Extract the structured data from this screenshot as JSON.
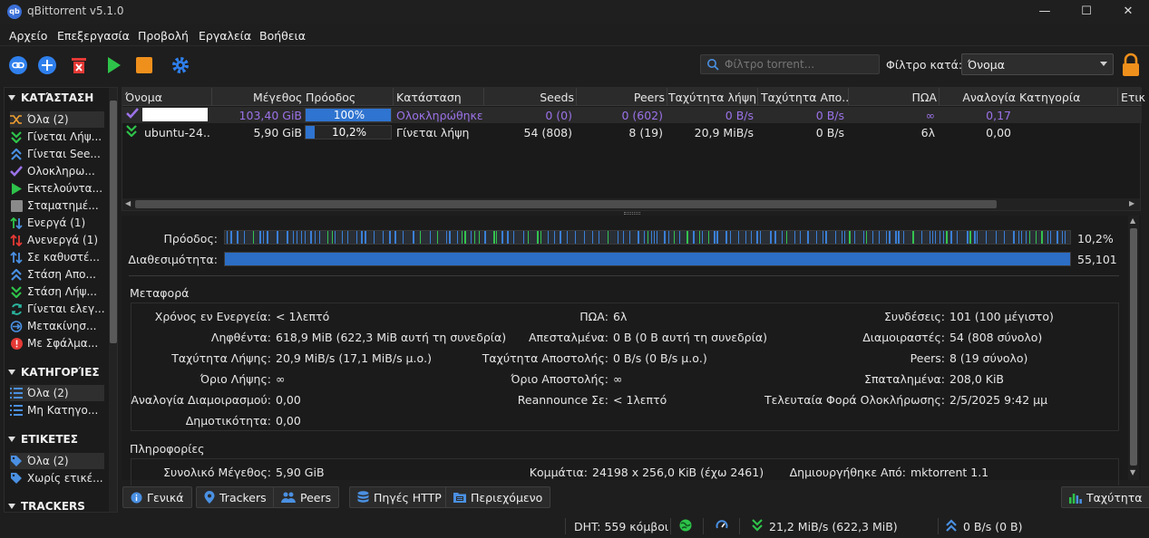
{
  "window": {
    "title": "qBittorrent v5.1.0",
    "minimize": "—",
    "maximize": "☐",
    "close": "✕"
  },
  "menu": [
    "Αρχείο",
    "Επεξεργασία",
    "Προβολή",
    "Εργαλεία",
    "Βοήθεια"
  ],
  "toolbar": {
    "search_placeholder": "Φίλτρο torrent...",
    "filter_label": "Φίλτρο κατά:",
    "filter_value": "Όνομα"
  },
  "sidebar": {
    "status_header": "ΚΑΤΆΣΤΑΣΗ",
    "status_items": [
      {
        "label": "Όλα (2)",
        "icon": "shuffle-icon"
      },
      {
        "label": "Γίνεται Λήψ...",
        "icon": "download-icon"
      },
      {
        "label": "Γίνεται See...",
        "icon": "upload-icon"
      },
      {
        "label": "Ολοκληρω...",
        "icon": "check-icon"
      },
      {
        "label": "Εκτελούντα...",
        "icon": "play-icon"
      },
      {
        "label": "Σταματημέ...",
        "icon": "stop-icon"
      },
      {
        "label": "Ενεργά (1)",
        "icon": "active-arrows-icon"
      },
      {
        "label": "Ανενεργά (1)",
        "icon": "inactive-arrows-icon"
      },
      {
        "label": "Σε καθυστέ...",
        "icon": "stalled-icon"
      },
      {
        "label": "Στάση Απο...",
        "icon": "stalled-upload-icon"
      },
      {
        "label": "Στάση Λήψ...",
        "icon": "stalled-download-icon"
      },
      {
        "label": "Γίνεται ελεγ...",
        "icon": "checking-icon"
      },
      {
        "label": "Μετακίνησ...",
        "icon": "moving-icon"
      },
      {
        "label": "Με Σφάλμα...",
        "icon": "error-icon"
      }
    ],
    "categories_header": "ΚΑΤΗΓΟΡΊΕΣ",
    "category_items": [
      "Όλα (2)",
      "Μη Κατηγο..."
    ],
    "tags_header": "ΕΤΙΚΕΤΕΣ",
    "tag_items": [
      "Όλα (2)",
      "Χωρίς ετικέ..."
    ],
    "trackers_header": "TRACKERS"
  },
  "table": {
    "columns": [
      "Όνομα",
      "Μέγεθος",
      "Πρόοδος",
      "Κατάσταση",
      "Seeds",
      "Peers",
      "Ταχύτητα λήψης",
      "Ταχύτητα Απο...",
      "ΠΩΑ",
      "Αναλογία",
      "Κατηγορία",
      "Ετικ"
    ],
    "rows": [
      {
        "name": "",
        "size": "103,40 GiB",
        "progress": 1.0,
        "progress_text": "100%",
        "status": "Ολοκληρώθηκε",
        "seeds": "0 (0)",
        "peers": "0 (602)",
        "down": "0 B/s",
        "up": "0 B/s",
        "eta": "∞",
        "ratio": "0,17",
        "color": "#9b72e8",
        "icon": "check-icon"
      },
      {
        "name": "ubuntu-24....",
        "size": "5,90 GiB",
        "progress": 0.102,
        "progress_text": "10,2%",
        "status": "Γίνεται λήψη",
        "seeds": "54 (808)",
        "peers": "8 (19)",
        "down": "20,9 MiB/s",
        "up": "0 B/s",
        "eta": "6λ",
        "ratio": "0,00",
        "color": "#e6e6e6",
        "icon": "download-icon"
      }
    ]
  },
  "details": {
    "progress_label": "Πρόοδος:",
    "progress_value": "10,2%",
    "availability_label": "Διαθεσιμότητα:",
    "availability_value": "55,101",
    "transfer_title": "Μεταφορά",
    "transfer": {
      "col1": [
        [
          "Χρόνος εν Ενεργεία:",
          "< 1λεπτό"
        ],
        [
          "Ληφθέντα:",
          "618,9 MiB (622,3 MiB αυτή τη συνεδρία)"
        ],
        [
          "Ταχύτητα Λήψης:",
          "20,9 MiB/s (17,1 MiB/s μ.ο.)"
        ],
        [
          "Όριο Λήψης:",
          "∞"
        ],
        [
          "Αναλογία Διαμοιρασμού:",
          "0,00"
        ],
        [
          "Δημοτικότητα:",
          "0,00"
        ]
      ],
      "col2": [
        [
          "ΠΩΑ:",
          "6λ"
        ],
        [
          "Απεσταλμένα:",
          "0 B (0 B αυτή τη συνεδρία)"
        ],
        [
          "Ταχύτητα Αποστολής:",
          "0 B/s (0 B/s μ.ο.)"
        ],
        [
          "Όριο Αποστολής:",
          "∞"
        ],
        [
          "Reannounce Σε:",
          "< 1λεπτό"
        ]
      ],
      "col3": [
        [
          "Συνδέσεις:",
          "101 (100 μέγιστο)"
        ],
        [
          "Διαμοιραστές:",
          "54 (808 σύνολο)"
        ],
        [
          "Peers:",
          "8 (19 σύνολο)"
        ],
        [
          "Σπαταλημένα:",
          "208,0 KiB"
        ],
        [
          "Τελευταία Φορά Ολοκλήρωσης:",
          "2/5/2025 9:42 μμ"
        ]
      ]
    },
    "info_title": "Πληροφορίες",
    "info": [
      [
        "Συνολικό Μέγεθος:",
        "5,90 GiB"
      ],
      [
        "Κομμάτια:",
        "24198 x 256,0 KiB (έχω 2461)"
      ],
      [
        "Δημιουργήθηκε Από:",
        "mktorrent 1.1"
      ]
    ]
  },
  "tabs": [
    "Γενικά",
    "Trackers",
    "Peers",
    "Πηγές HTTP",
    "Περιεχόμενο"
  ],
  "speed_tab": "Ταχύτητα",
  "status": {
    "dht": "DHT: 559 κόμβοι",
    "download": "21,2 MiB/s (622,3 MiB)",
    "upload": "0 B/s (0 B)"
  }
}
